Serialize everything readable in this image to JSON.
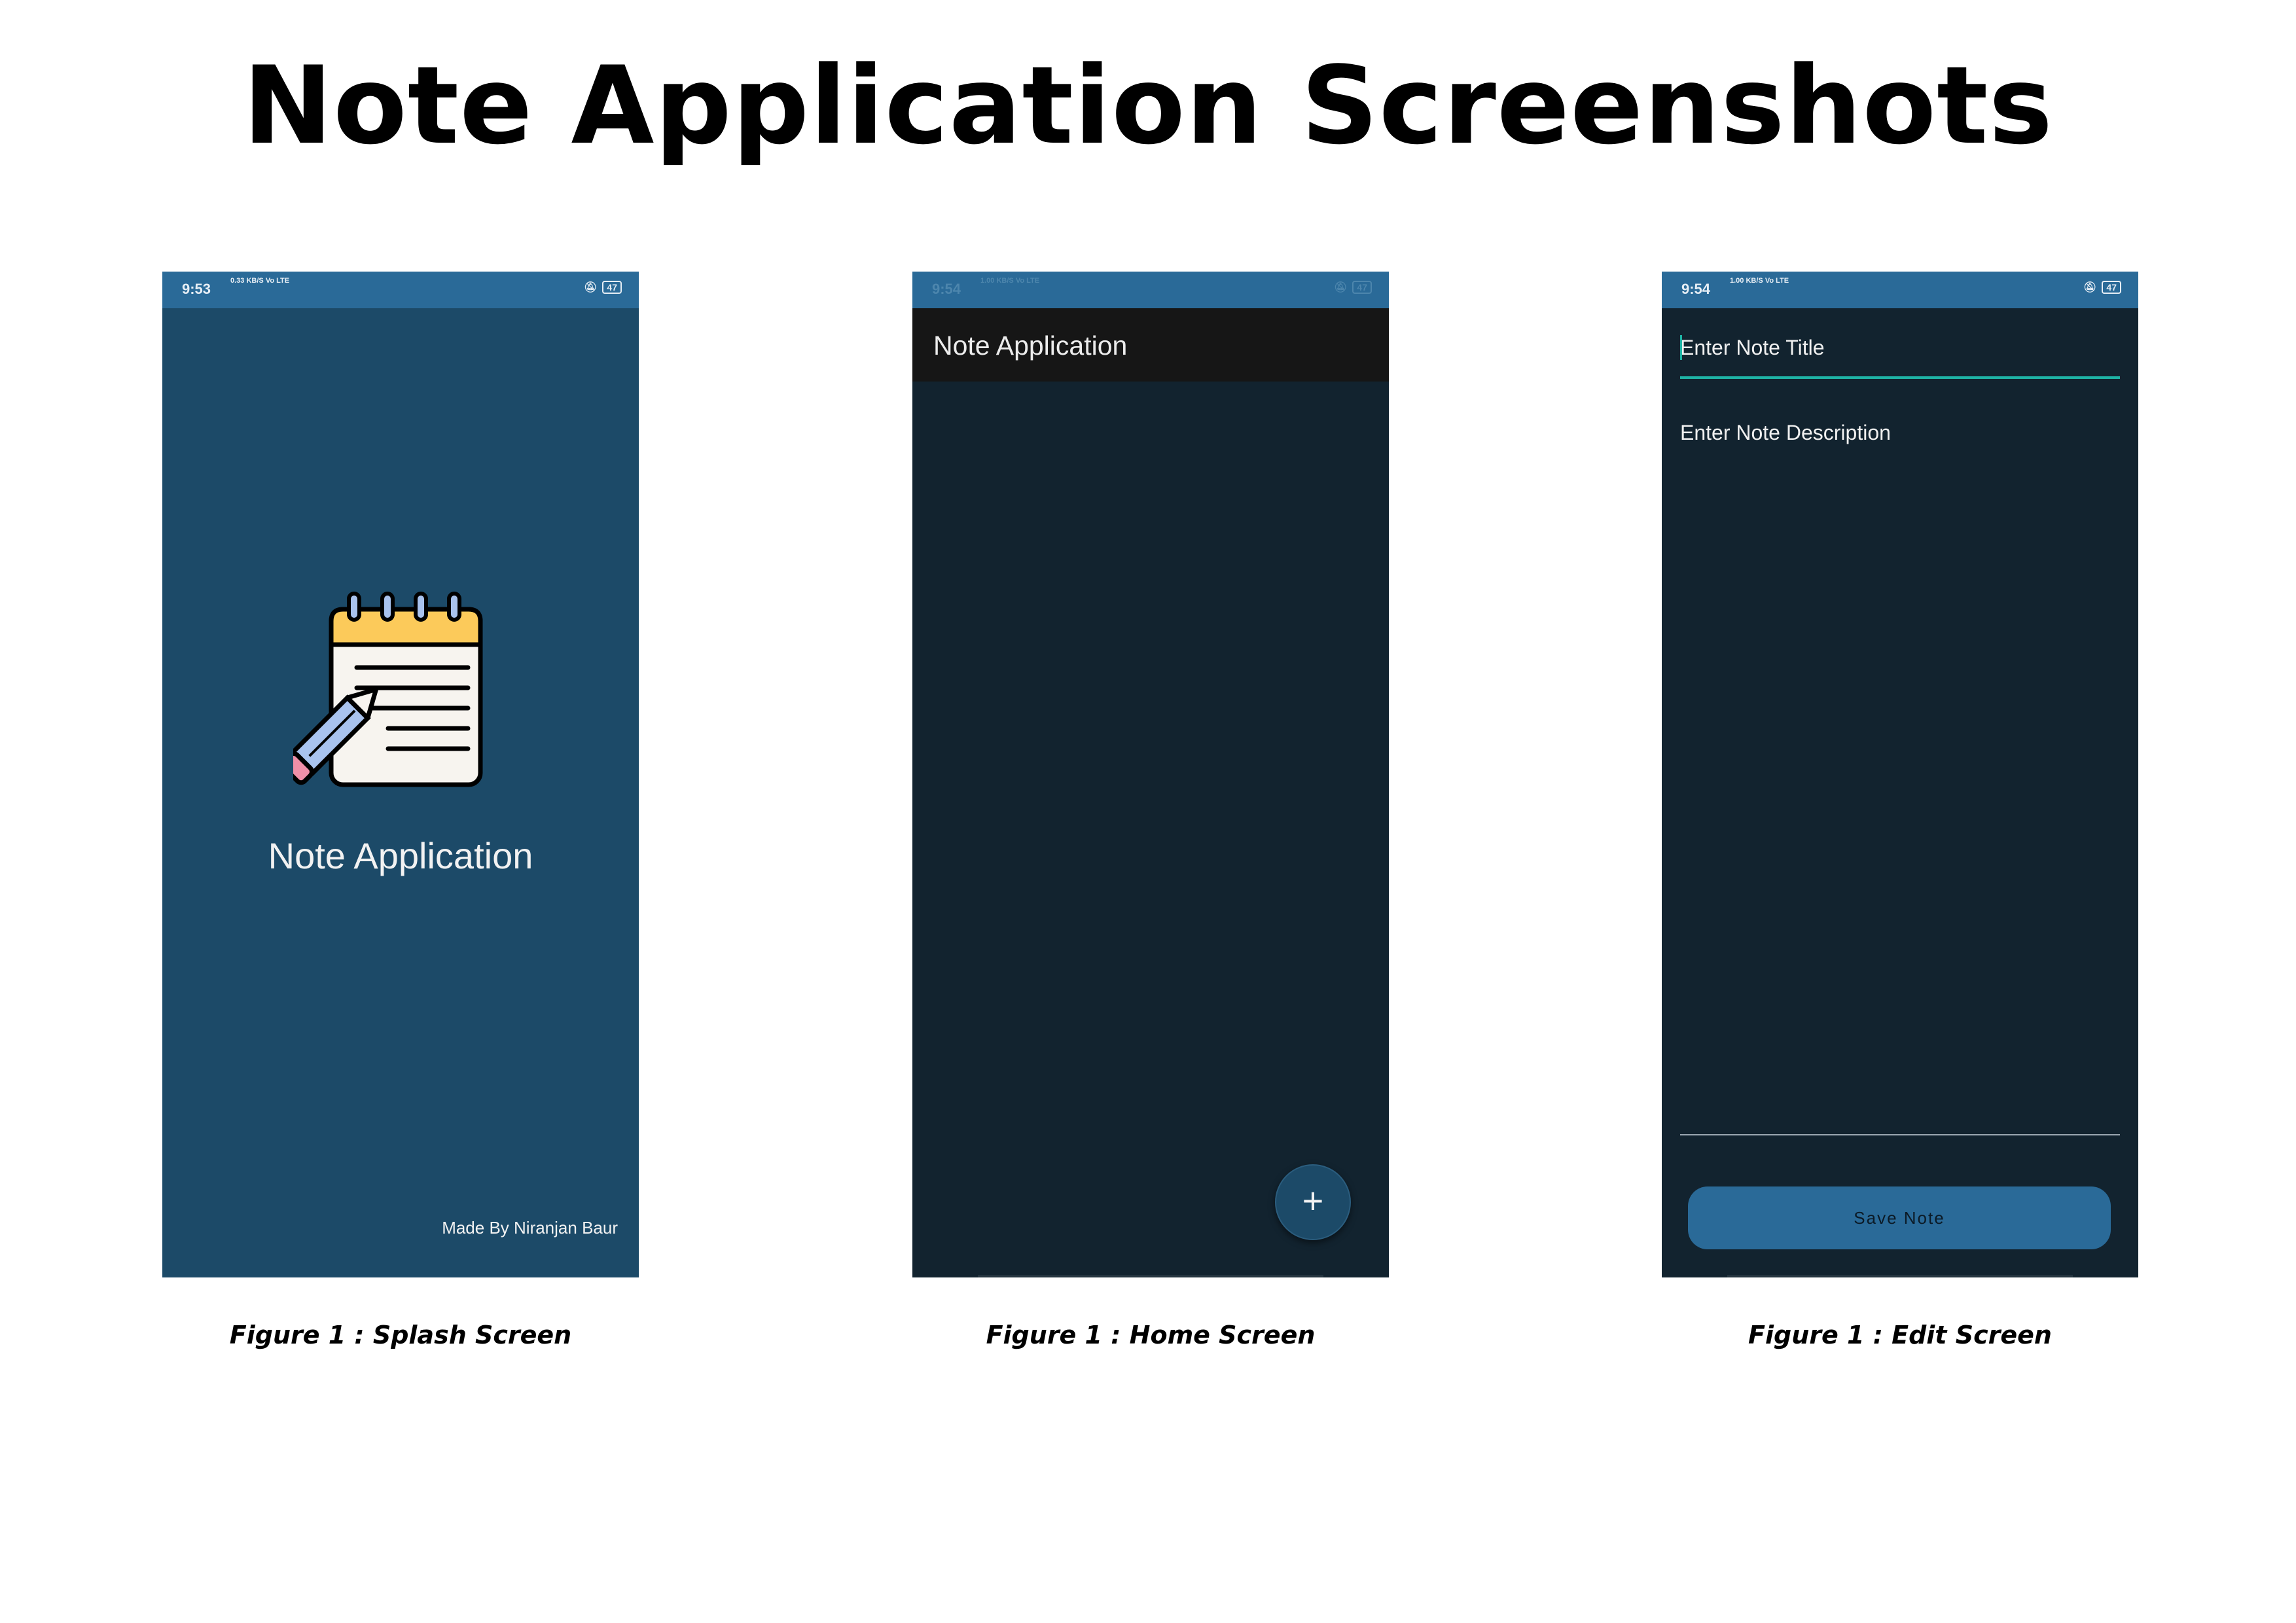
{
  "page": {
    "title": "Note Application Screenshots"
  },
  "splash": {
    "status": {
      "time": "9:53",
      "net_rate": "0.33 KB/S",
      "net_type": "Vo LTE",
      "battery": "47"
    },
    "logo_icon": "notepad-pencil-icon",
    "app_name": "Note Application",
    "made_by": "Made By Niranjan Baur",
    "caption": "Figure 1 : Splash Screen",
    "background_color": "#1c4a68"
  },
  "home": {
    "status": {
      "time": "9:54",
      "net_rate": "1.00 KB/S",
      "net_type": "Vo LTE",
      "battery": "47"
    },
    "toolbar_title": "Note Application",
    "fab_label": "+",
    "fab_icon": "plus-icon",
    "caption": "Figure 1 : Home Screen",
    "background_color": "#12232f"
  },
  "edit": {
    "status": {
      "time": "9:54",
      "net_rate": "1.00 KB/S",
      "net_type": "Vo LTE",
      "battery": "47"
    },
    "title_placeholder": "Enter Note Title",
    "description_placeholder": "Enter Note Description",
    "save_label": "Save Note",
    "caption": "Figure 1 : Edit Screen",
    "accent_color": "#1eb3a5",
    "button_color": "#2a6a98"
  }
}
